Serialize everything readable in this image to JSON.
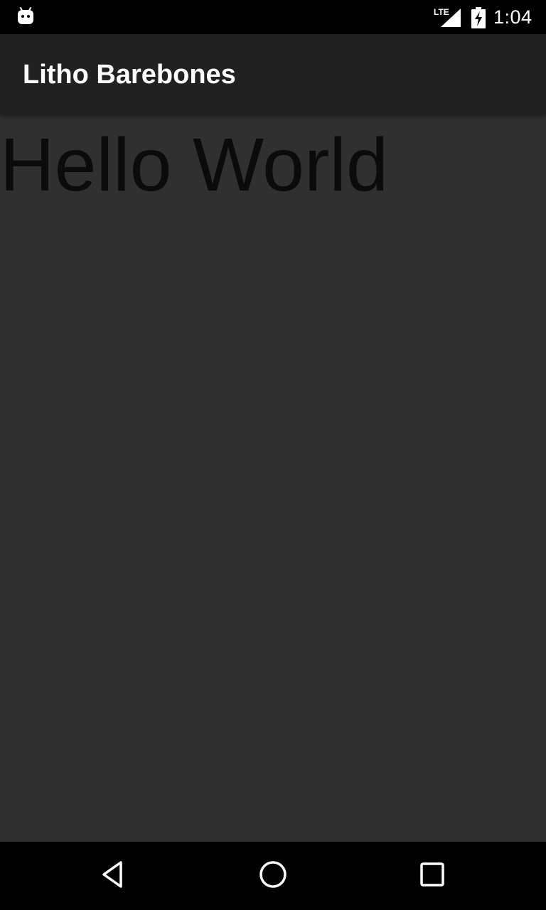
{
  "status_bar": {
    "time": "1:04",
    "network_type": "LTE",
    "icons": [
      "android-notification-icon",
      "signal-icon",
      "battery-charging-icon"
    ]
  },
  "app_bar": {
    "title": "Litho Barebones"
  },
  "content": {
    "text": "Hello World"
  },
  "nav_bar": {
    "buttons": [
      "back-icon",
      "home-icon",
      "recents-icon"
    ]
  },
  "colors": {
    "status_bar_bg": "#000000",
    "app_bar_bg": "#212121",
    "content_bg": "#303030",
    "hello_text": "#0b0b0b",
    "nav_bar_bg": "#000000"
  }
}
